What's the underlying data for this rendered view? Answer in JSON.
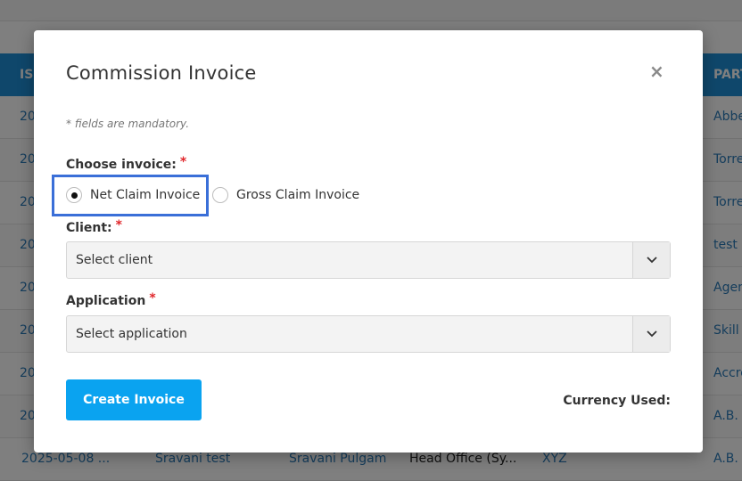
{
  "background": {
    "header": {
      "col_left": "IS",
      "col_right": "PART"
    },
    "rows": [
      {
        "date": "20",
        "partner": "Abbe"
      },
      {
        "date": "20",
        "partner": "Torre"
      },
      {
        "date": "20",
        "partner": "Torre"
      },
      {
        "date": "20",
        "partner": "test p"
      },
      {
        "date": "20",
        "partner": "Agen"
      },
      {
        "date": "20",
        "partner": "Skill"
      },
      {
        "date": "20",
        "partner": "Accre"
      },
      {
        "date": "20",
        "partner": "A.B."
      }
    ],
    "last_row": {
      "date": "2025-05-08 ...",
      "name": "Sravani test",
      "user": "Sravani Pulgam",
      "office": "Head Office (Sy...",
      "code": "XYZ",
      "partner": "A.B."
    }
  },
  "modal": {
    "title": "Commission Invoice",
    "close_symbol": "×",
    "note": "* fields are mandatory.",
    "required_marker": "*",
    "choose_invoice_label": "Choose invoice:",
    "invoice_options": [
      {
        "label": "Net Claim Invoice",
        "checked": true
      },
      {
        "label": "Gross Claim Invoice",
        "checked": false
      }
    ],
    "client_label": "Client:",
    "client_select": "Select client",
    "application_label": "Application",
    "application_select": "Select application",
    "create_button": "Create Invoice",
    "currency_label": "Currency Used:"
  },
  "colors": {
    "table_header": "#1e8fd6",
    "primary_button": "#0aa3f0",
    "focus_ring": "#3a6fd8",
    "required": "#e0262a"
  }
}
